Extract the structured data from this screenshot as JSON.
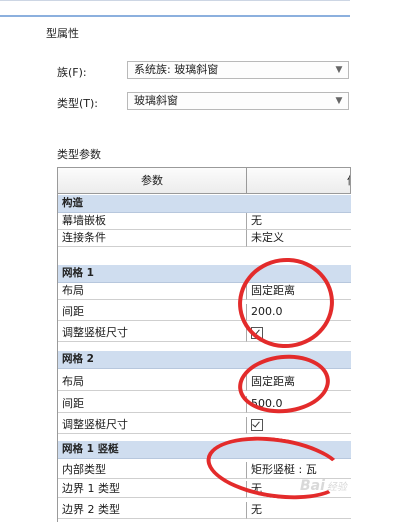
{
  "window": {
    "title": "型属性"
  },
  "family": {
    "label": "族(F):",
    "value": "系统族: 玻璃斜窗"
  },
  "type": {
    "label": "类型(T):",
    "value": "玻璃斜窗"
  },
  "params": {
    "section_title": "类型参数",
    "col_param": "参数",
    "col_value_partial": "值",
    "groups": [
      {
        "name": "构造",
        "rows": [
          {
            "param": "幕墙嵌板",
            "value": "无"
          },
          {
            "param": "连接条件",
            "value": "未定义"
          }
        ]
      },
      {
        "name": "网格 1",
        "rows": [
          {
            "param": "布局",
            "value": "固定距离"
          },
          {
            "param": "间距",
            "value": "200.0"
          },
          {
            "param": "调整竖梃尺寸",
            "value": ""
          }
        ]
      },
      {
        "name": "网格 2",
        "rows": [
          {
            "param": "布局",
            "value": "固定距离"
          },
          {
            "param": "间距",
            "value": "500.0"
          },
          {
            "param": "调整竖梃尺寸",
            "value": ""
          }
        ]
      },
      {
        "name": "网格 1 竖梃",
        "rows": [
          {
            "param": "内部类型",
            "value": "矩形竖梃 : 瓦"
          },
          {
            "param": "边界 1 类型",
            "value": "无"
          },
          {
            "param": "边界 2 类型",
            "value": "无"
          }
        ]
      }
    ]
  },
  "watermark": {
    "brand": "Bai",
    "tail": "经验"
  },
  "colors": {
    "annotation": "#e32b2b",
    "group_bg": "#cfddef"
  }
}
